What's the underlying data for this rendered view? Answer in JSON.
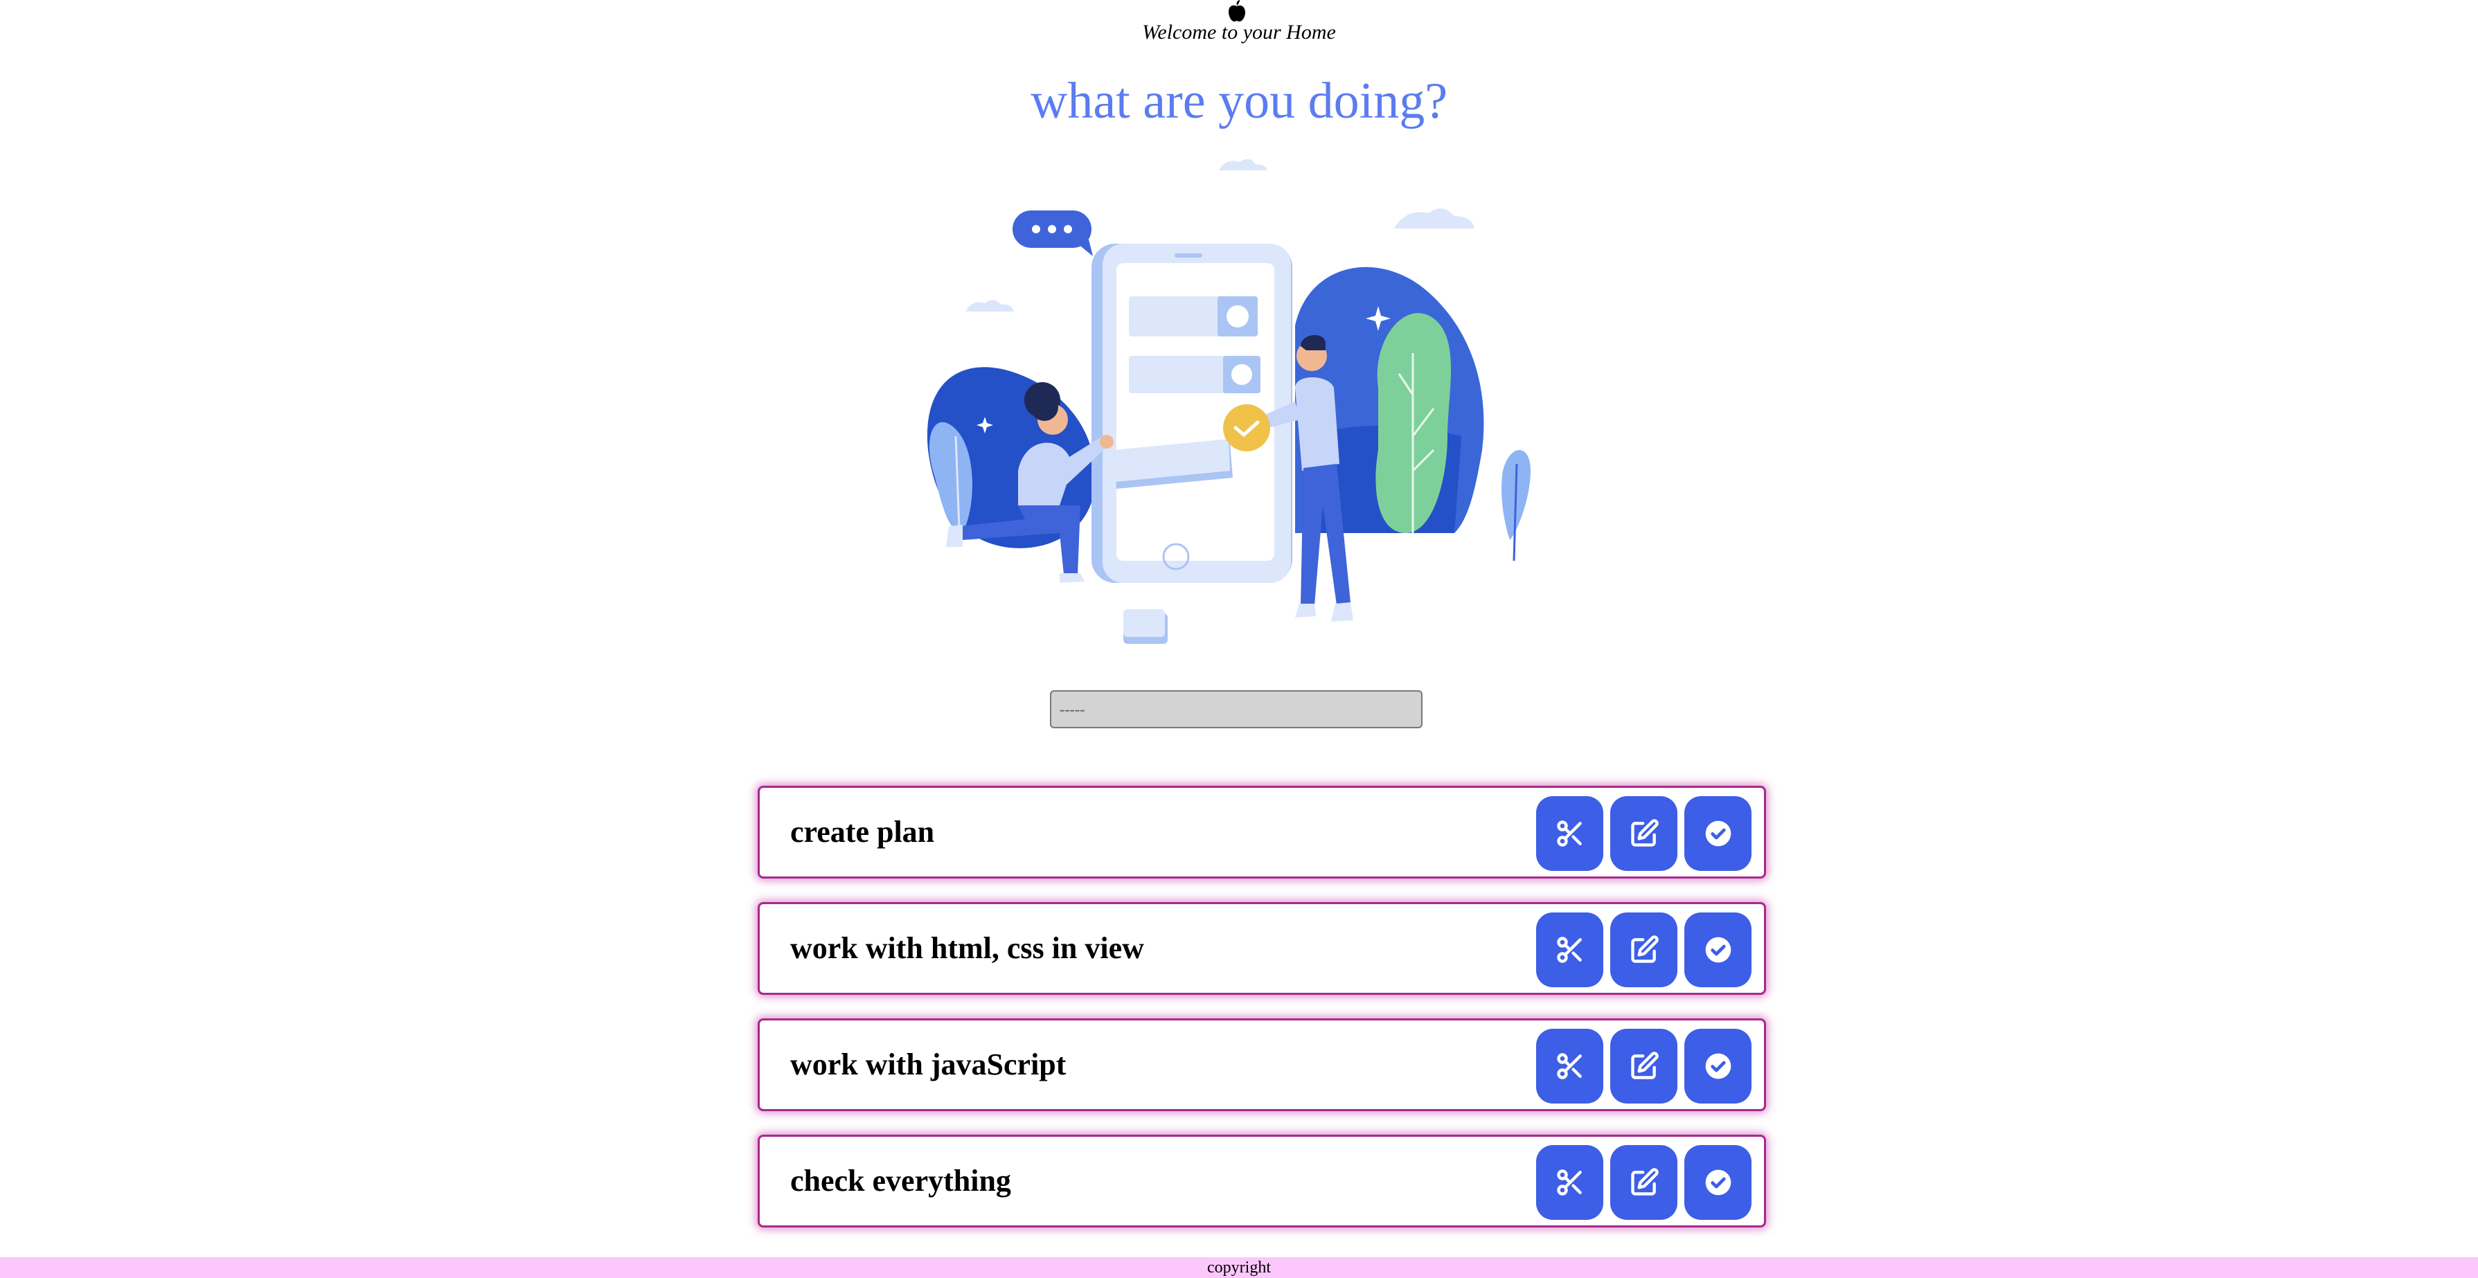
{
  "header": {
    "logo_icon": "apple-icon",
    "welcome_text": "Welcome to your Home",
    "title": "what are you doing?"
  },
  "illustration": {
    "icon": "task-illustration"
  },
  "task_input": {
    "value": "",
    "placeholder": "-----"
  },
  "todos": [
    {
      "text": "create plan"
    },
    {
      "text": "work with html, css in view"
    },
    {
      "text": "work with javaScript"
    },
    {
      "text": "check everything"
    }
  ],
  "actions": {
    "delete_icon": "scissors-icon",
    "edit_icon": "edit-icon",
    "complete_icon": "check-circle-icon"
  },
  "colors": {
    "title": "#5b7cf0",
    "button": "#3d5ee6",
    "item_border": "#a62a8c",
    "footer": "#fcc7fc",
    "input_bg": "#d3d3d3"
  },
  "footer": {
    "text": "copyright"
  }
}
